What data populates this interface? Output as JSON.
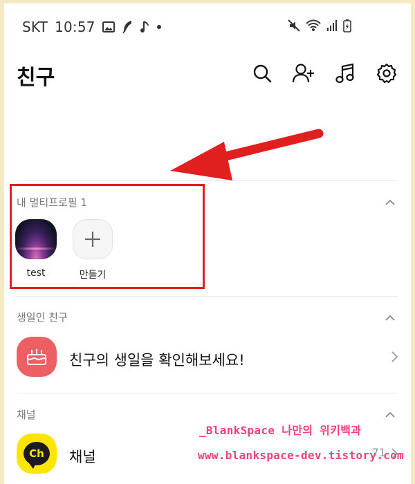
{
  "status_bar": {
    "carrier": "SKT",
    "time": "10:57",
    "icons": [
      "gallery-icon",
      "feather-icon",
      "music-note-icon",
      "dot-icon"
    ],
    "right_icons": [
      "mute-icon",
      "wifi-icon",
      "signal-icon",
      "battery-charging-icon"
    ]
  },
  "header": {
    "title": "친구",
    "icons": [
      "search-icon",
      "add-friend-icon",
      "music-icon",
      "settings-icon"
    ]
  },
  "multiprofile": {
    "title": "내 멀티프로필",
    "count": "1",
    "items": [
      {
        "label": "test"
      },
      {
        "label": "만들기"
      }
    ]
  },
  "birthday": {
    "section_title": "생일인 친구",
    "row_text": "친구의 생일을 확인해보세요!"
  },
  "channel": {
    "section_title": "채널",
    "row_text": "채널",
    "icon_text": "Ch",
    "count": "71"
  },
  "watermark": {
    "line1": "_BlankSpace 나만의 위키백과",
    "line2": "www.blankspace-dev.tistory.com"
  },
  "colors": {
    "highlight_red": "#e01f1f",
    "birthday_icon": "#ec5f63",
    "channel_icon": "#fde500",
    "watermark": "#f2407a",
    "background": "#f3e9c3"
  }
}
